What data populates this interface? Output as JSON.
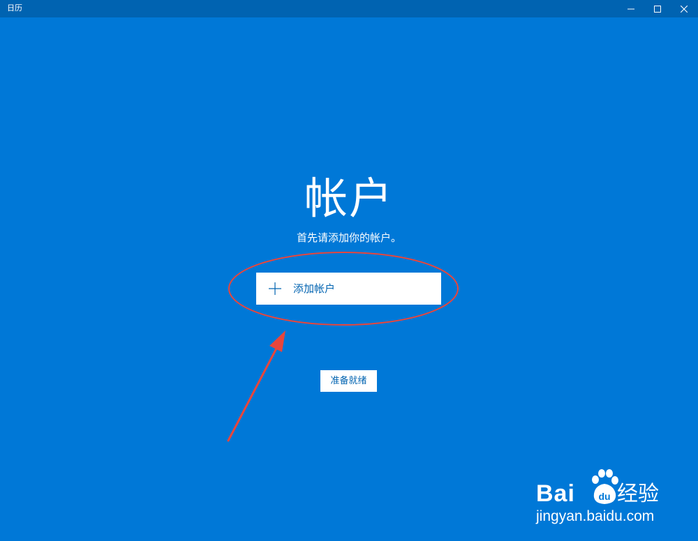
{
  "window": {
    "title": "日历",
    "controls": {
      "minimize": "minimize-icon",
      "maximize": "maximize-icon",
      "close": "close-icon"
    }
  },
  "main": {
    "heading": "帐户",
    "subtitle": "首先请添加你的帐户。",
    "add_account": {
      "icon": "plus-icon",
      "label": "添加帐户"
    },
    "ready_button": "准备就绪"
  },
  "annotation": {
    "color": "#e8463c",
    "shapes": [
      "ellipse-highlight",
      "arrow"
    ]
  },
  "watermark": {
    "brand_latin": "Bai",
    "brand_du": "du",
    "brand_cn": "经验",
    "domain": "jingyan.baidu.com"
  },
  "colors": {
    "background": "#0078d7",
    "titlebar": "#0063b1",
    "button_background": "#ffffff",
    "button_text": "#0063b1"
  }
}
